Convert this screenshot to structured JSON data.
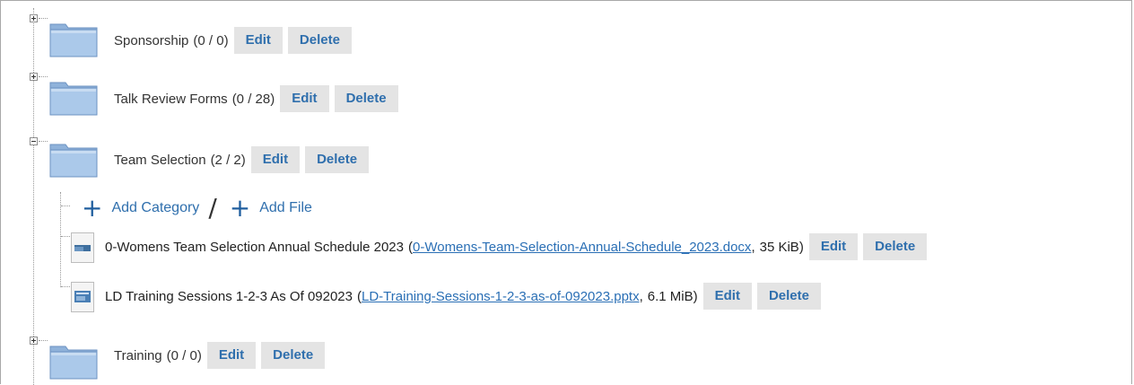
{
  "tree": {
    "categories": [
      {
        "name": "Sponsorship",
        "count": "(0 / 0)",
        "edit_label": "Edit",
        "delete_label": "Delete",
        "expander": "collapsed"
      },
      {
        "name": "Talk Review Forms",
        "count": "(0 / 28)",
        "edit_label": "Edit",
        "delete_label": "Delete",
        "expander": "collapsed"
      },
      {
        "name": "Team Selection",
        "count": "(2 / 2)",
        "edit_label": "Edit",
        "delete_label": "Delete",
        "expander": "expanded"
      },
      {
        "name": "Training",
        "count": "(0 / 0)",
        "edit_label": "Edit",
        "delete_label": "Delete",
        "expander": "collapsed"
      }
    ],
    "add_actions": {
      "add_category_label": "Add Category",
      "separator": "/",
      "add_file_label": "Add File"
    },
    "files": [
      {
        "title": "0-Womens Team Selection Annual Schedule 2023",
        "filename": "0-Womens-Team-Selection-Annual-Schedule_2023.docx",
        "size": "35 KiB",
        "edit_label": "Edit",
        "delete_label": "Delete",
        "icon": "document-thumbnail-icon"
      },
      {
        "title": "LD Training Sessions 1-2-3 As Of 092023",
        "filename": "LD-Training-Sessions-1-2-3-as-of-092023.pptx",
        "size": "6.1 MiB",
        "edit_label": "Edit",
        "delete_label": "Delete",
        "icon": "presentation-thumbnail-icon"
      }
    ]
  },
  "colors": {
    "button_bg": "#e4e4e4",
    "button_text": "#2f6fad",
    "link": "#2a6fb5",
    "folder": "#a9c6e6"
  },
  "punctuation": {
    "open": "(",
    "comma": ",",
    "close": ")"
  }
}
